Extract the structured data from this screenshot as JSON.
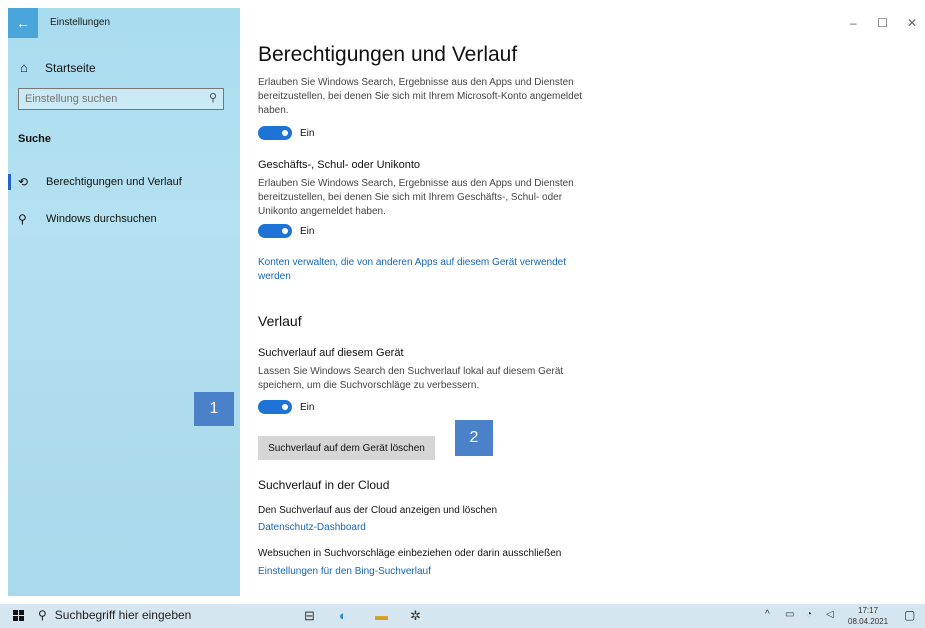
{
  "window": {
    "app_title": "Einstellungen",
    "back_icon": "back-arrow-icon",
    "controls": {
      "minimize": "–",
      "maximize": "☐",
      "close": "✕"
    }
  },
  "sidebar": {
    "home_label": "Startseite",
    "search_placeholder": "Einstellung suchen",
    "section_label": "Suche",
    "items": [
      {
        "label": "Berechtigungen und Verlauf",
        "icon": "permissions-icon",
        "active": true
      },
      {
        "label": "Windows durchsuchen",
        "icon": "search-icon",
        "active": false
      }
    ]
  },
  "main": {
    "title": "Berechtigungen und Verlauf",
    "ms_account_desc": "Erlauben Sie Windows Search, Ergebnisse aus den Apps und Diensten bereitzustellen, bei denen Sie sich mit Ihrem Microsoft-Konto angemeldet haben.",
    "toggle1_label": "Ein",
    "work_heading": "Geschäfts-, Schul- oder Unikonto",
    "work_desc": "Erlauben Sie Windows Search, Ergebnisse aus den Apps und Diensten bereitzustellen, bei denen Sie sich mit Ihrem Geschäfts-, Schul- oder Unikonto angemeldet haben.",
    "toggle2_label": "Ein",
    "manage_accounts_link": "Konten verwalten, die von anderen Apps auf diesem Gerät verwendet werden",
    "history_heading": "Verlauf",
    "device_history_heading": "Suchverlauf auf diesem Gerät",
    "device_history_desc": "Lassen Sie Windows Search den Suchverlauf lokal auf diesem Gerät speichern, um die Suchvorschläge zu verbessern.",
    "toggle3_label": "Ein",
    "clear_button": "Suchverlauf auf dem Gerät löschen",
    "cloud_heading": "Suchverlauf in der Cloud",
    "cloud_desc": "Den Suchverlauf aus der Cloud anzeigen und löschen",
    "privacy_link": "Datenschutz-Dashboard",
    "web_search_desc": "Websuchen in Suchvorschläge einbeziehen oder darin ausschließen",
    "bing_link": "Einstellungen für den Bing-Suchverlauf"
  },
  "markers": {
    "one": "1",
    "two": "2"
  },
  "taskbar": {
    "search_placeholder": "Suchbegriff hier eingeben",
    "time": "17:17",
    "date": "08.04.2021"
  },
  "colors": {
    "accent": "#1e73d6",
    "link": "#1667b5",
    "marker": "#4a81c9",
    "sidebar": "#b4e1f1"
  }
}
